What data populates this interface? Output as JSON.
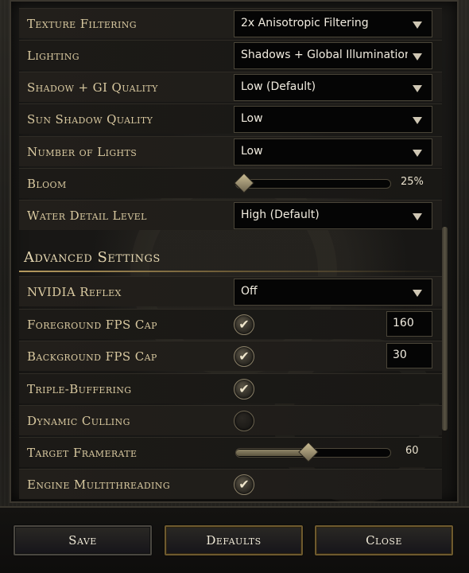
{
  "graphics": [
    {
      "label": "Texture Filtering",
      "type": "dropdown",
      "value": "2x Anisotropic Filtering"
    },
    {
      "label": "Lighting",
      "type": "dropdown",
      "value": "Shadows + Global Illumination"
    },
    {
      "label": "Shadow + GI Quality",
      "type": "dropdown",
      "value": "Low (Default)"
    },
    {
      "label": "Sun Shadow Quality",
      "type": "dropdown",
      "value": "Low"
    },
    {
      "label": "Number of Lights",
      "type": "dropdown",
      "value": "Low"
    },
    {
      "label": "Bloom",
      "type": "slider",
      "value": "25%",
      "fraction": 0.05
    },
    {
      "label": "Water Detail Level",
      "type": "dropdown",
      "value": "High (Default)"
    }
  ],
  "advanced": {
    "title": "Advanced Settings",
    "rows": [
      {
        "label": "NVIDIA Reflex",
        "type": "dropdown",
        "value": "Off"
      },
      {
        "label": "Foreground FPS Cap",
        "type": "checkbox-number",
        "checked": true,
        "value": "160"
      },
      {
        "label": "Background FPS Cap",
        "type": "checkbox-number",
        "checked": true,
        "value": "30"
      },
      {
        "label": "Triple-Buffering",
        "type": "checkbox",
        "checked": true
      },
      {
        "label": "Dynamic Culling",
        "type": "checkbox",
        "checked": false
      },
      {
        "label": "Target Framerate",
        "type": "slider",
        "value": "60",
        "fraction": 0.47
      },
      {
        "label": "Engine Multithreading",
        "type": "checkbox",
        "checked": true
      }
    ]
  },
  "buttons": {
    "save": "Save",
    "defaults": "Defaults",
    "close": "Close"
  },
  "icons": {
    "checkmark": "check-icon",
    "dropdown": "chevron-down-icon"
  }
}
